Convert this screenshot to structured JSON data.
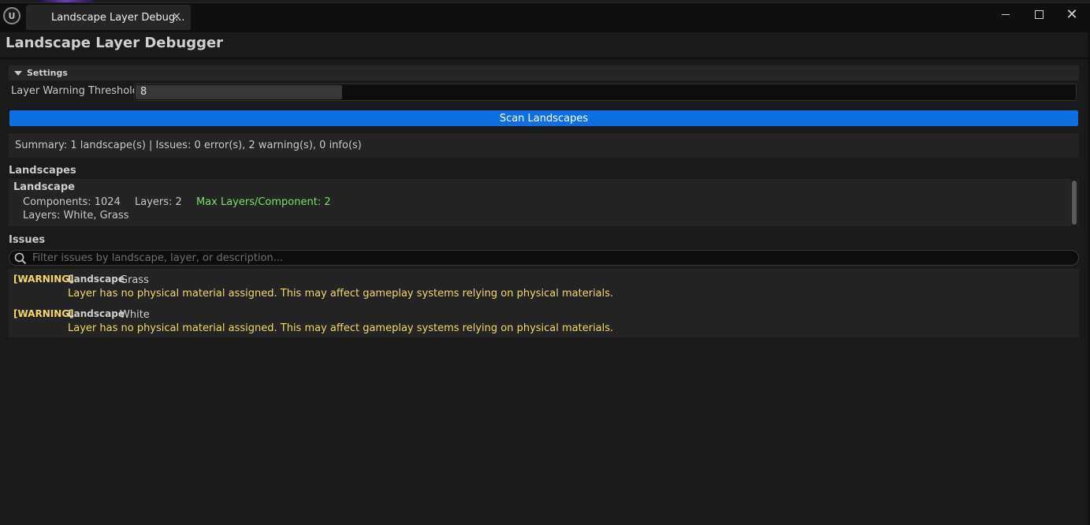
{
  "window": {
    "tab_title": "Landscape Layer Debug...",
    "tab_close": "×",
    "close_glyph": "✕"
  },
  "panel": {
    "title": "Landscape Layer Debugger"
  },
  "settings": {
    "header": "Settings",
    "threshold_label": "Layer Warning Threshold:",
    "threshold_value": "8",
    "threshold_fraction": 0.22
  },
  "scan_button": "Scan Landscapes",
  "summary": "Summary: 1 landscape(s) | Issues: 0 error(s), 2 warning(s), 0 info(s)",
  "landscapes": {
    "label": "Landscapes",
    "items": [
      {
        "name": "Landscape",
        "components": "Components: 1024",
        "layers_count": "Layers: 2",
        "max_layers": "Max Layers/Component: 2",
        "layers": "Layers: White, Grass"
      }
    ]
  },
  "issues": {
    "label": "Issues",
    "filter_placeholder": "Filter issues by landscape, layer, or description...",
    "items": [
      {
        "tag": "[WARNING]",
        "landscape": "Landscape",
        "layer": "Grass",
        "message": "Layer has no physical material assigned. This may affect gameplay systems relying on physical materials."
      },
      {
        "tag": "[WARNING]",
        "landscape": "Landscape",
        "layer": "White",
        "message": "Layer has no physical material assigned. This may affect gameplay systems relying on physical materials."
      }
    ]
  },
  "colors": {
    "accent": "#0e6fe0",
    "warning": "#f2d66c",
    "ok_green": "#7ddc6e",
    "background": "#1a1a1a"
  },
  "icons": [
    "unreal-logo-icon",
    "close-icon",
    "minimize-icon",
    "maximize-icon",
    "collapse-triangle-icon",
    "search-icon"
  ]
}
